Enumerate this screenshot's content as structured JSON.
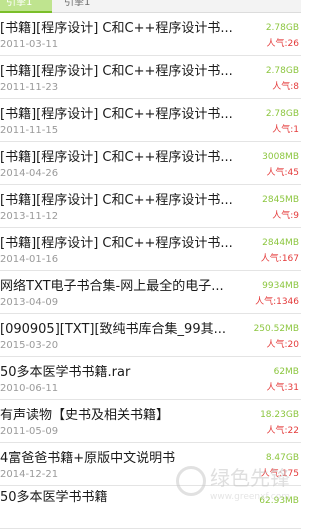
{
  "tabs": [
    {
      "label": "引擎1",
      "active": true
    },
    {
      "label": "引擎1",
      "active": false
    }
  ],
  "colors": {
    "tab_active_bg": "#bfe48f",
    "size_green": "#8cc63f",
    "popularity_red": "#e43b3b",
    "date_gray": "#9a9a9a"
  },
  "results": [
    {
      "title": "[书籍][程序设计] C和C++程序设计书...",
      "date": "2011-03-11",
      "size": "2.78GB",
      "popularity": "人气:26"
    },
    {
      "title": "[书籍][程序设计] C和C++程序设计书...",
      "date": "2011-11-23",
      "size": "2.78GB",
      "popularity": "人气:8"
    },
    {
      "title": "[书籍][程序设计] C和C++程序设计书...",
      "date": "2011-11-15",
      "size": "2.78GB",
      "popularity": "人气:1"
    },
    {
      "title": "[书籍][程序设计] C和C++程序设计书...",
      "date": "2014-04-26",
      "size": "3008MB",
      "popularity": "人气:45"
    },
    {
      "title": "[书籍][程序设计] C和C++程序设计书...",
      "date": "2013-11-12",
      "size": "2845MB",
      "popularity": "人气:9"
    },
    {
      "title": "[书籍][程序设计] C和C++程序设计书...",
      "date": "2014-01-16",
      "size": "2844MB",
      "popularity": "人气:167"
    },
    {
      "title": "网络TXT电子书合集-网上最全的电子...",
      "date": "2013-04-09",
      "size": "9934MB",
      "popularity": "人气:1346"
    },
    {
      "title": "[090905][TXT][致纯书库合集_99其...",
      "date": "2015-03-20",
      "size": "250.52MB",
      "popularity": "人气:20"
    },
    {
      "title": "50多本医学书书籍.rar",
      "date": "2010-06-11",
      "size": "62MB",
      "popularity": "人气:31"
    },
    {
      "title": "有声读物【史书及相关书籍】",
      "date": "2011-05-09",
      "size": "18.23GB",
      "popularity": "人气:22"
    },
    {
      "title": "4富爸爸书籍+原版中文说明书",
      "date": "2014-12-21",
      "size": "8.47GB",
      "popularity": "人气:175"
    },
    {
      "title": "50多本医学书书籍",
      "date": "",
      "size": "62.93MB",
      "popularity": ""
    }
  ],
  "watermark": {
    "text": "绿色先锋",
    "url": "www.greenxf.com"
  }
}
